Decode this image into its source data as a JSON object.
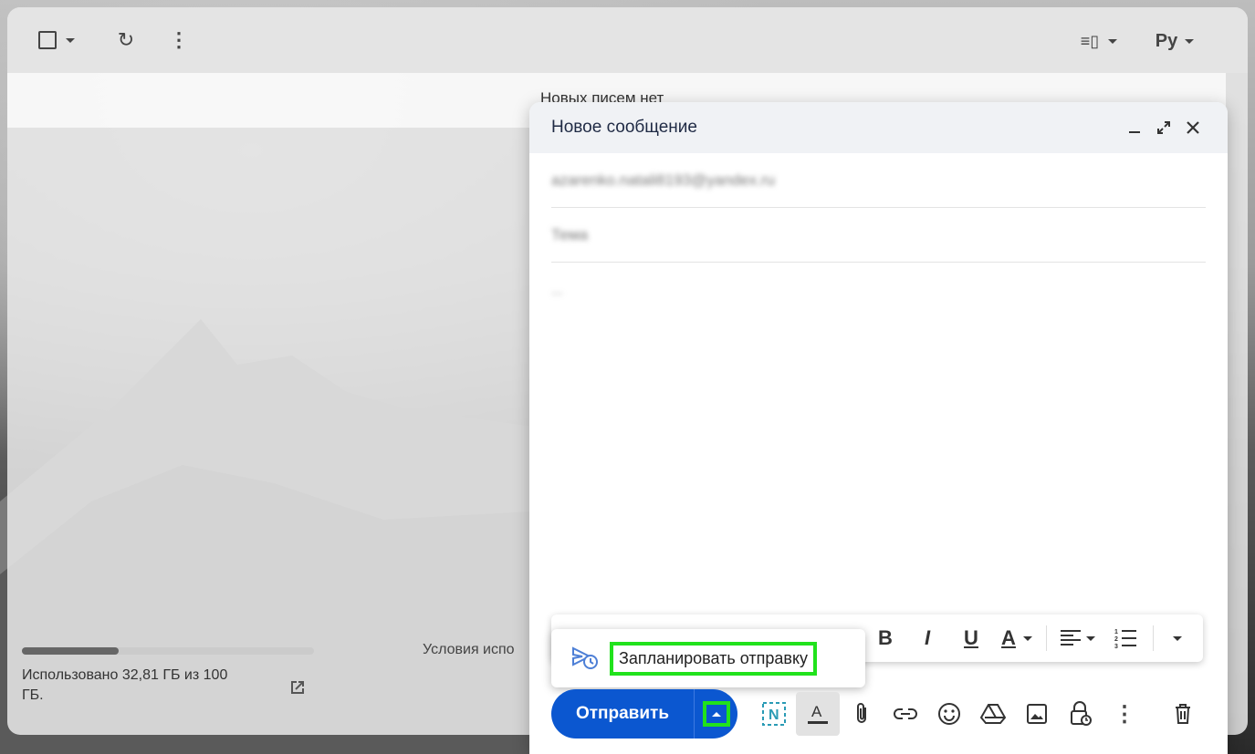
{
  "topbar": {
    "layout_toggle_label": "≡▯",
    "language_label": "Ру"
  },
  "info": {
    "no_new_mail": "Новых писем нет"
  },
  "storage": {
    "used_fraction": 0.33,
    "text": "Использовано 32,81 ГБ из 100 ГБ.",
    "terms_text": "Условия испо"
  },
  "compose": {
    "title": "Новое сообщение",
    "to_value": "azarenko.natali8193@yandex.ru",
    "subject_value": "Тема",
    "body_value": "...",
    "send_label": "Отправить",
    "schedule_label": "Запланировать отправку"
  },
  "formatting": {
    "bold": "B",
    "italic": "I",
    "underline": "U",
    "text_color": "A"
  },
  "colors": {
    "send_blue": "#0b57d0",
    "highlight_green": "#21e21c"
  }
}
